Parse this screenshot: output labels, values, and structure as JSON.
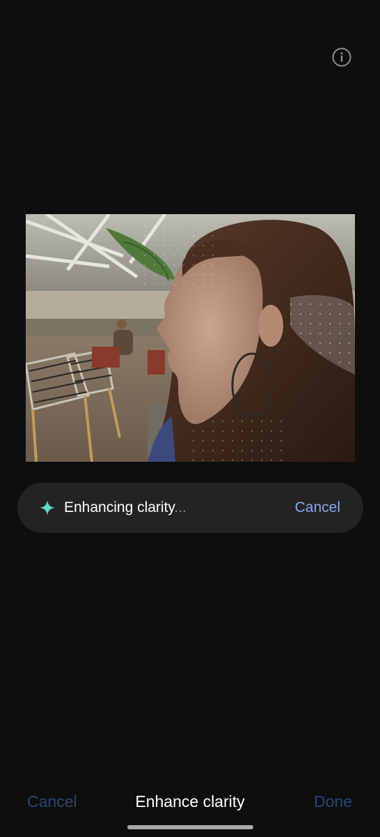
{
  "header": {
    "info_icon": "info-circle-icon"
  },
  "photo": {
    "subject": "woman-profile-cafe-photo"
  },
  "status": {
    "icon": "sparkle-icon",
    "text": "Enhancing clarity",
    "ellipsis": "...",
    "cancel_label": "Cancel",
    "accent_color": "#86a7f2",
    "sparkle_color": "#5fd9c9"
  },
  "bottom_bar": {
    "cancel_label": "Cancel",
    "title": "Enhance clarity",
    "done_label": "Done",
    "disabled_color": "#2b4577"
  }
}
